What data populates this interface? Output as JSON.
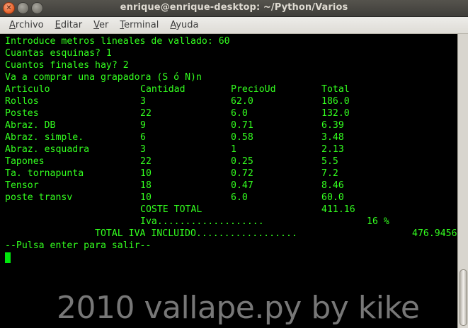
{
  "window": {
    "title": "enrique@enrique-desktop: ~/Python/Varios",
    "buttons": {
      "close": "✕",
      "minimize": "",
      "maximize": ""
    }
  },
  "menu": {
    "items": [
      {
        "label_u": "A",
        "label_rest": "rchivo"
      },
      {
        "label_u": "E",
        "label_rest": "ditar"
      },
      {
        "label_u": "V",
        "label_rest": "er"
      },
      {
        "label_u": "T",
        "label_rest": "erminal"
      },
      {
        "label_u": "A",
        "label_rest": "yuda"
      }
    ]
  },
  "terminal": {
    "colors": {
      "text": "#33ff1f",
      "background": "#000000",
      "cursor": "#00e60c"
    },
    "prompts": [
      "Introduce metros lineales de vallado: 60",
      "Cuantas esquinas? 1",
      "Cuantos finales hay? 2",
      "Va a comprar una grapadora (S ó N)n"
    ],
    "table": {
      "headers": [
        "Articulo",
        "Cantidad",
        "PrecioUd",
        "Total"
      ],
      "rows": [
        [
          "Rollos",
          "3",
          "62.0",
          "186.0"
        ],
        [
          "Postes",
          "22",
          "6.0",
          "132.0"
        ],
        [
          "Abraz. DB",
          "9",
          "0.71",
          "6.39"
        ],
        [
          "Abraz. simple.",
          "6",
          "0.58",
          "3.48"
        ],
        [
          "Abraz. esquadra",
          "3",
          "1",
          "2.13"
        ],
        [
          "Tapones",
          "22",
          "0.25",
          "5.5"
        ],
        [
          "Ta. tornapunta",
          "10",
          "0.72",
          "7.2"
        ],
        [
          "Tensor",
          "18",
          "0.47",
          "8.46"
        ],
        [
          "poste transv",
          "10",
          "6.0",
          "60.0"
        ]
      ]
    },
    "totals": {
      "coste_label": "COSTE TOTAL",
      "coste_value": "411.16",
      "iva_label": "Iva...................",
      "iva_value": "16 %",
      "total_label": "TOTAL IVA INCLUIDO..................",
      "total_value": "476.9456"
    },
    "exit_prompt": "--Pulsa enter para salir--"
  },
  "watermark": "2010 vallape.py by kike"
}
